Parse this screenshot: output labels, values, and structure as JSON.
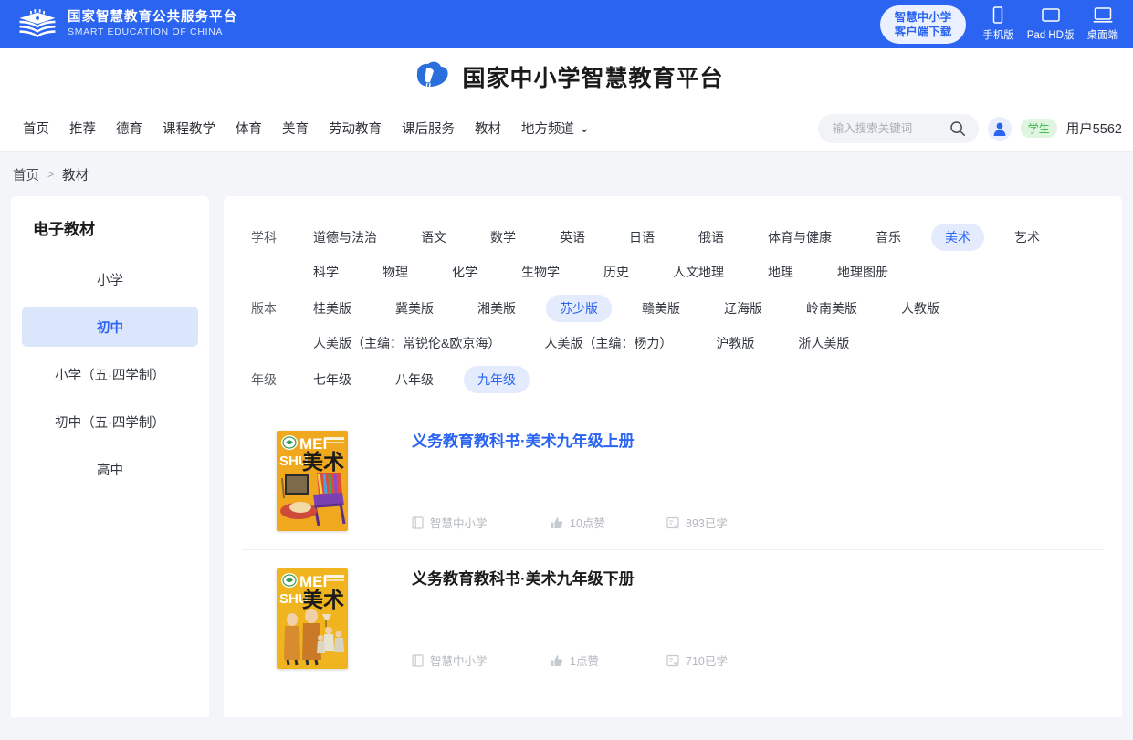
{
  "topbar": {
    "brand_cn": "国家智慧教育公共服务平台",
    "brand_en": "SMART EDUCATION OF CHINA",
    "client_download_line1": "智慧中小学",
    "client_download_line2": "客户端下载",
    "devices": [
      {
        "label": "手机版",
        "icon": "phone-icon"
      },
      {
        "label": "Pad HD版",
        "icon": "tablet-icon"
      },
      {
        "label": "桌面端",
        "icon": "desktop-icon"
      }
    ],
    "accent_color": "#2a64f0"
  },
  "platform": {
    "title": "国家中小学智慧教育平台",
    "logo_icon": "cloud-book-logo"
  },
  "nav": {
    "items": [
      {
        "label": "首页"
      },
      {
        "label": "推荐"
      },
      {
        "label": "德育"
      },
      {
        "label": "课程教学"
      },
      {
        "label": "体育"
      },
      {
        "label": "美育"
      },
      {
        "label": "劳动教育"
      },
      {
        "label": "课后服务"
      },
      {
        "label": "教材"
      },
      {
        "label": "地方频道",
        "caret": "⌄"
      }
    ]
  },
  "search": {
    "placeholder": "输入搜索关键词",
    "value": "",
    "icon": "search-icon"
  },
  "user": {
    "avatar_icon": "user-avatar-icon",
    "role": "学生",
    "name": "用户5562",
    "role_color": "#3bb54a"
  },
  "breadcrumb": {
    "home": "首页",
    "separator": ">",
    "current": "教材"
  },
  "sidebar": {
    "title": "电子教材",
    "items": [
      {
        "label": "小学",
        "active": false
      },
      {
        "label": "初中",
        "active": true
      },
      {
        "label": "小学（五·四学制）",
        "active": false
      },
      {
        "label": "初中（五·四学制）",
        "active": false
      },
      {
        "label": "高中",
        "active": false
      }
    ]
  },
  "filters": [
    {
      "label": "学科",
      "options": [
        {
          "label": "道德与法治",
          "active": false
        },
        {
          "label": "语文",
          "active": false
        },
        {
          "label": "数学",
          "active": false
        },
        {
          "label": "英语",
          "active": false
        },
        {
          "label": "日语",
          "active": false
        },
        {
          "label": "俄语",
          "active": false
        },
        {
          "label": "体育与健康",
          "active": false
        },
        {
          "label": "音乐",
          "active": false
        },
        {
          "label": "美术",
          "active": true
        },
        {
          "label": "艺术",
          "active": false
        },
        {
          "label": "科学",
          "active": false
        },
        {
          "label": "物理",
          "active": false
        },
        {
          "label": "化学",
          "active": false
        },
        {
          "label": "生物学",
          "active": false
        },
        {
          "label": "历史",
          "active": false
        },
        {
          "label": "人文地理",
          "active": false
        },
        {
          "label": "地理",
          "active": false
        },
        {
          "label": "地理图册",
          "active": false
        }
      ]
    },
    {
      "label": "版本",
      "options": [
        {
          "label": "桂美版",
          "active": false
        },
        {
          "label": "冀美版",
          "active": false
        },
        {
          "label": "湘美版",
          "active": false
        },
        {
          "label": "苏少版",
          "active": true
        },
        {
          "label": "赣美版",
          "active": false
        },
        {
          "label": "辽海版",
          "active": false
        },
        {
          "label": "岭南美版",
          "active": false
        },
        {
          "label": "人教版",
          "active": false
        },
        {
          "label": "人美版（主编：常锐伦&欧京海）",
          "active": false
        },
        {
          "label": "人美版（主编：杨力）",
          "active": false
        },
        {
          "label": "沪教版",
          "active": false
        },
        {
          "label": "浙人美版",
          "active": false
        }
      ]
    },
    {
      "label": "年级",
      "options": [
        {
          "label": "七年级",
          "active": false
        },
        {
          "label": "八年级",
          "active": false
        },
        {
          "label": "九年级",
          "active": true
        }
      ]
    }
  ],
  "books": [
    {
      "title": "义务教育教科书·美术九年级上册",
      "title_highlighted": true,
      "publisher": "智慧中小学",
      "likes": "10点赞",
      "studied": "893已学",
      "cover": {
        "bg": "#f0a81e",
        "title_cn": "美术",
        "title_pin_1": "MEI",
        "title_pin_2": "SHU",
        "art": "chair"
      }
    },
    {
      "title": "义务教育教科书·美术九年级下册",
      "title_highlighted": false,
      "publisher": "智慧中小学",
      "likes": "1点赞",
      "studied": "710已学",
      "cover": {
        "bg": "#f0b41e",
        "title_cn": "美术",
        "title_pin_1": "MEI",
        "title_pin_2": "SHU",
        "art": "figures"
      }
    }
  ],
  "icons": {
    "publisher": "book-icon",
    "likes": "thumbs-up-icon",
    "studied": "study-record-icon"
  }
}
